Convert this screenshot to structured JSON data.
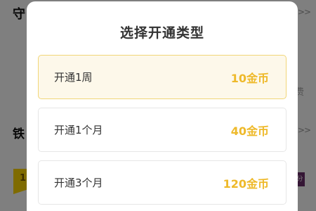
{
  "background": {
    "section_guard_title": "守",
    "section_iron_title": "铁",
    "arrow_text": ">>",
    "fee_text": "费",
    "tag_text": "1",
    "badge_text": "分"
  },
  "modal": {
    "title": "选择开通类型",
    "options": [
      {
        "label": "开通1周",
        "price": "10金币",
        "selected": true
      },
      {
        "label": "开通1个月",
        "price": "40金币",
        "selected": false
      },
      {
        "label": "开通3个月",
        "price": "120金币",
        "selected": false
      }
    ]
  },
  "colors": {
    "accent": "#eeb92a",
    "selected_bg": "#fdf8ea",
    "selected_border": "#f1d678",
    "overlay": "rgba(0,0,0,0.5)"
  }
}
